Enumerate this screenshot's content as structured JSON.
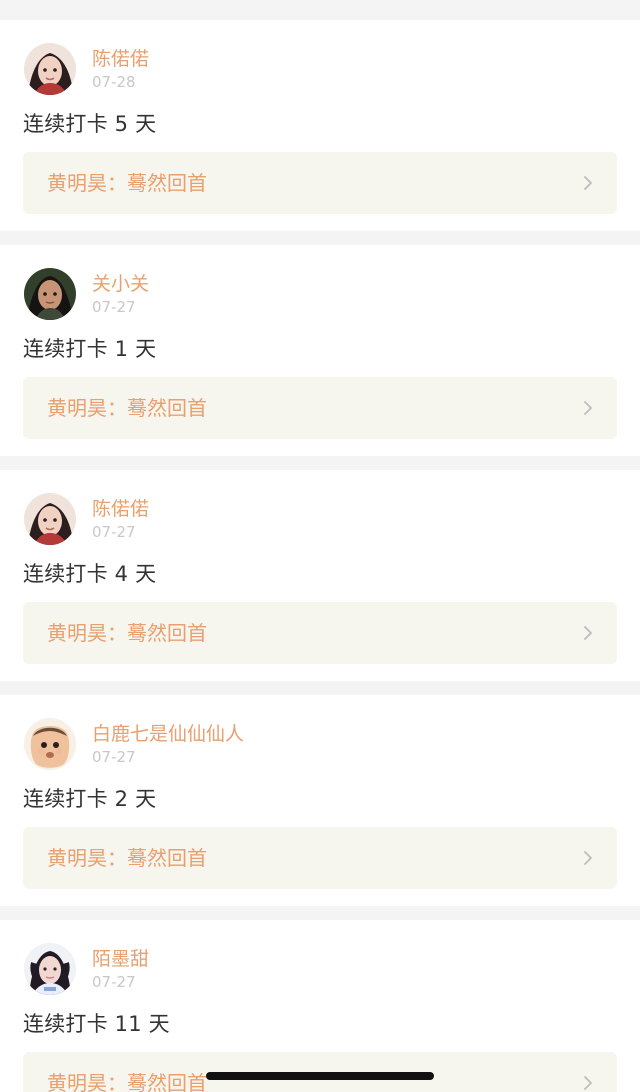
{
  "posts": [
    {
      "username": "陈偌偌",
      "date": "07-28",
      "streak": "连续打卡 5 天",
      "link_text": "黄明昊：蓦然回首",
      "avatar_icon": "avatar-icon"
    },
    {
      "username": "关小关",
      "date": "07-27",
      "streak": "连续打卡 1 天",
      "link_text": "黄明昊：蓦然回首",
      "avatar_icon": "avatar-icon"
    },
    {
      "username": "陈偌偌",
      "date": "07-27",
      "streak": "连续打卡 4 天",
      "link_text": "黄明昊：蓦然回首",
      "avatar_icon": "avatar-icon"
    },
    {
      "username": "白鹿七是仙仙仙人",
      "date": "07-27",
      "streak": "连续打卡 2 天",
      "link_text": "黄明昊：蓦然回首",
      "avatar_icon": "avatar-icon"
    },
    {
      "username": "陌墨甜",
      "date": "07-27",
      "streak": "连续打卡 11 天",
      "link_text": "黄明昊：蓦然回首",
      "avatar_icon": "avatar-icon"
    }
  ],
  "colors": {
    "accent": "#e8a06f",
    "date": "#c8c8c8",
    "text": "#333333",
    "card_bg": "#f6f5ee",
    "page_bg": "#f4f4f4"
  }
}
